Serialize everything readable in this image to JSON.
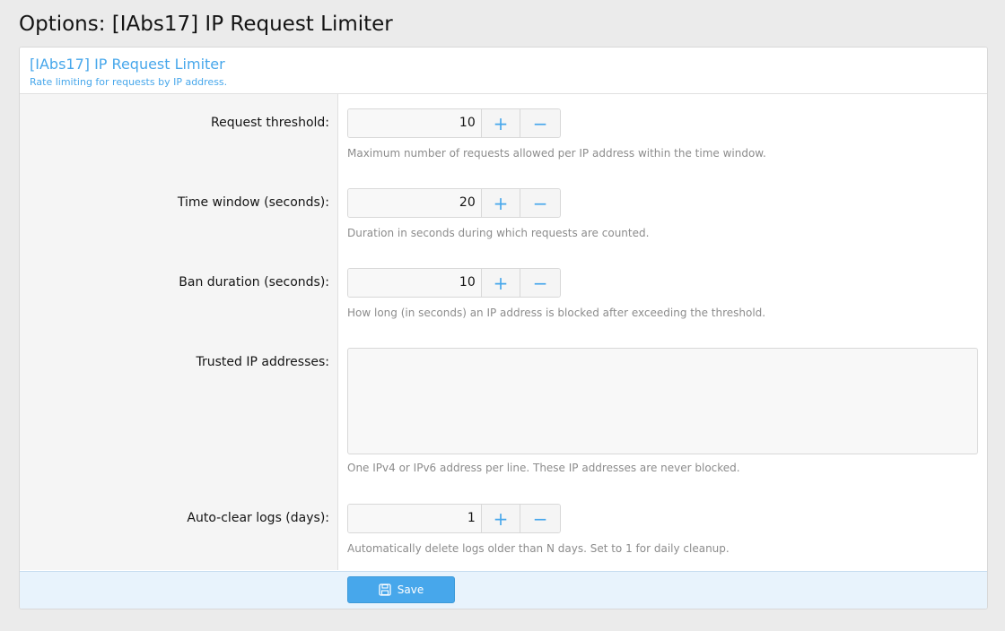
{
  "page": {
    "title": "Options: [IAbs17] IP Request Limiter"
  },
  "block": {
    "title": "[IAbs17] IP Request Limiter",
    "description": "Rate limiting for requests by IP address."
  },
  "fields": {
    "threshold": {
      "label": "Request threshold:",
      "value": "10",
      "hint": "Maximum number of requests allowed per IP address within the time window."
    },
    "time_window": {
      "label": "Time window (seconds):",
      "value": "20",
      "hint": "Duration in seconds during which requests are counted."
    },
    "ban_duration": {
      "label": "Ban duration (seconds):",
      "value": "10",
      "hint": "How long (in seconds) an IP address is blocked after exceeding the threshold."
    },
    "trusted_ips": {
      "label": "Trusted IP addresses:",
      "value": "",
      "hint": "One IPv4 or IPv6 address per line. These IP addresses are never blocked."
    },
    "auto_clear": {
      "label": "Auto-clear logs (days):",
      "value": "1",
      "hint": "Automatically delete logs older than N days. Set to 1 for daily cleanup."
    }
  },
  "spin": {
    "plus": "+",
    "minus": "−"
  },
  "footer": {
    "save_label": "Save"
  },
  "icons": {
    "save": "floppy-disk-icon"
  },
  "colors": {
    "accent": "#47a7eb",
    "footer_bg": "#e8f3fc"
  }
}
